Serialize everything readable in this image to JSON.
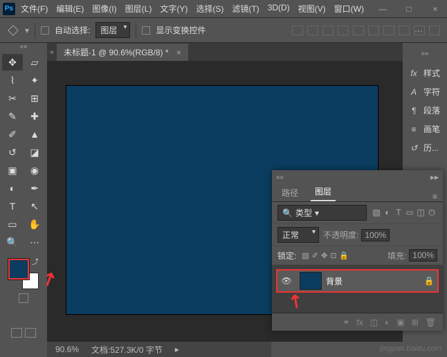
{
  "app": {
    "logo": "Ps"
  },
  "menu": {
    "file": "文件(F)",
    "edit": "编辑(E)",
    "image": "图像(I)",
    "layer": "图层(L)",
    "type": "文字(Y)",
    "select": "选择(S)",
    "filter": "滤镜(T)",
    "threeD": "3D(D)",
    "view": "视图(V)",
    "window": "窗口(W)"
  },
  "win": {
    "min": "—",
    "max": "□",
    "close": "×"
  },
  "optbar": {
    "autoSelect": "自动选择:",
    "layerSel": "图层",
    "showTransform": "显示变换控件"
  },
  "docTab": {
    "title": "未标题-1 @ 90.6%(RGB/8) *",
    "close": "×"
  },
  "rightPanels": {
    "styles": "样式",
    "character": "字符",
    "paragraph": "段落",
    "brushes": "画笔",
    "history": "历...",
    "stylesIcon": "fx",
    "charIcon": "A",
    "paraIcon": "¶"
  },
  "layersPanel": {
    "tabPaths": "路径",
    "tabLayers": "图层",
    "searchLabel": "类型",
    "blendMode": "正常",
    "opacityLabel": "不透明度:",
    "opacityVal": "100%",
    "lockLabel": "锁定:",
    "fillLabel": "填充:",
    "fillVal": "100%",
    "layerName": "背景"
  },
  "status": {
    "zoom": "90.6%",
    "doc": "文档:527.3K/0 字节"
  },
  "colors": {
    "canvas": "#0a3d5f",
    "highlight": "#e33"
  },
  "watermark": "jingyan.baidu.com"
}
